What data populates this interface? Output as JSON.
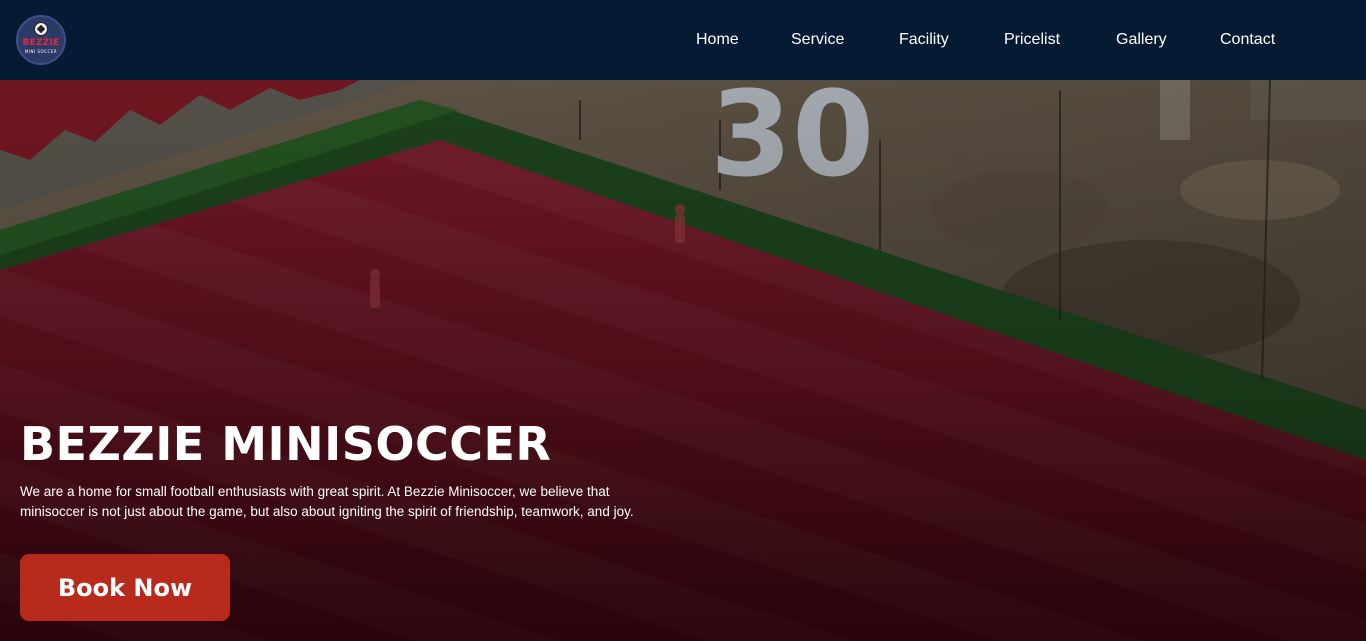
{
  "header": {
    "logo": {
      "text": "BEZZIE",
      "subtext": "MINI SOCCER",
      "icon": "soccer-ball-icon"
    },
    "nav": [
      {
        "label": "Home"
      },
      {
        "label": "Service"
      },
      {
        "label": "Facility"
      },
      {
        "label": "Pricelist"
      },
      {
        "label": "Gallery"
      },
      {
        "label": "Contact"
      }
    ]
  },
  "hero": {
    "background_sign": "30",
    "title": "BEZZIE MINISOCCER",
    "description": "We are a home for small football enthusiasts with great spirit. At Bezzie Minisoccer, we believe that minisoccer is not just about the game, but also about igniting the spirit of friendship, teamwork, and joy.",
    "cta_label": "Book Now"
  },
  "colors": {
    "header_bg": "#051a33",
    "cta_bg": "#b82a1c",
    "field_red": "#7a1424",
    "text": "#ffffff"
  }
}
